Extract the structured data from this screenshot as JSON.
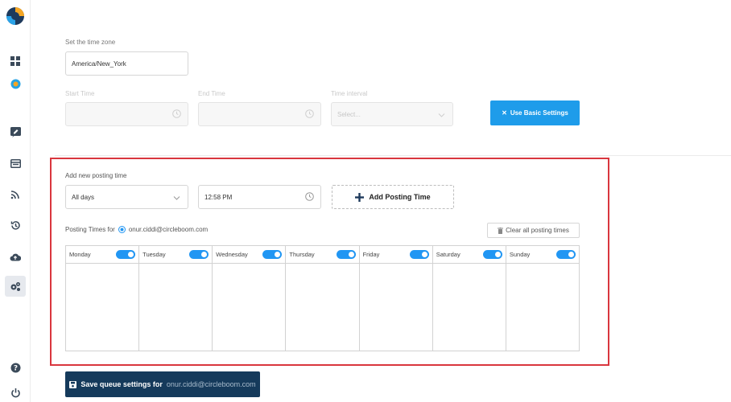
{
  "timezone": {
    "label": "Set the time zone",
    "value": "America/New_York"
  },
  "basic_settings": {
    "start_time_label": "Start Time",
    "end_time_label": "End Time",
    "interval_label": "Time interval",
    "interval_placeholder": "Select...",
    "use_basic_button": "Use Basic Settings"
  },
  "posting": {
    "add_label": "Add new posting time",
    "days_value": "All days",
    "time_value": "12:58 PM",
    "add_button": "Add Posting Time",
    "times_for_label": "Posting Times for",
    "account": "onur.ciddi@circleboom.com",
    "clear_button": "Clear all posting times",
    "days": [
      {
        "name": "Monday",
        "enabled": true
      },
      {
        "name": "Tuesday",
        "enabled": true
      },
      {
        "name": "Wednesday",
        "enabled": true
      },
      {
        "name": "Thursday",
        "enabled": true
      },
      {
        "name": "Friday",
        "enabled": true
      },
      {
        "name": "Saturday",
        "enabled": true
      },
      {
        "name": "Sunday",
        "enabled": true
      }
    ]
  },
  "save": {
    "label": "Save queue settings for",
    "account": "onur.ciddi@circleboom.com"
  },
  "sidebar": {
    "icons": [
      "logo-icon",
      "dashboard-icon",
      "circle-badge-icon",
      "compose-icon",
      "calendar-icon",
      "rss-icon",
      "history-icon",
      "cloud-upload-icon",
      "settings-icon",
      "help-icon",
      "power-icon"
    ]
  },
  "colors": {
    "accent": "#1e9cea",
    "toggle": "#2196f3",
    "save_button": "#153a5b",
    "highlight_border": "#d9363e"
  }
}
